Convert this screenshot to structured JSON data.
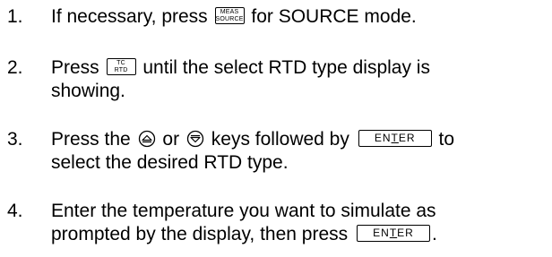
{
  "steps": [
    {
      "number": "1.",
      "text_a": "If necessary, press",
      "key_top": "MEAS",
      "key_bottom": "SOURCE",
      "text_b": "for SOURCE mode."
    },
    {
      "number": "2.",
      "text_a": "Press",
      "key_top": "TC",
      "key_bottom": "RTD",
      "text_b": "until the select RTD type display is",
      "text_c": "showing."
    },
    {
      "number": "3.",
      "text_a": "Press the",
      "text_b": "or",
      "text_c": "keys followed by",
      "enter_pre": "EN",
      "enter_u": "T",
      "enter_post": "ER",
      "text_d": "to",
      "text_e": "select the desired RTD type."
    },
    {
      "number": "4.",
      "text_a": "Enter the temperature you want to simulate as",
      "text_b": "prompted by the display, then press",
      "enter_pre": "EN",
      "enter_u": "T",
      "enter_post": "ER",
      "text_c": "."
    }
  ],
  "icons": [
    "up-arrow-key-icon",
    "down-arrow-key-icon"
  ]
}
